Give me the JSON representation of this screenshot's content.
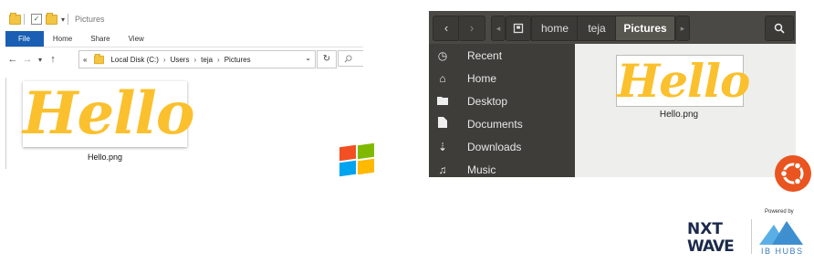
{
  "windows_explorer": {
    "title": "Pictures",
    "ribbon_tabs": [
      "File",
      "Home",
      "Share",
      "View"
    ],
    "breadcrumb": [
      "Local Disk (C:)",
      "Users",
      "teja",
      "Pictures"
    ],
    "breadcrumb_prefix": "«",
    "separator": "›",
    "file": {
      "image_text": "Hello",
      "name": "Hello.png"
    },
    "colors": {
      "file_tab": "#1a5fb4",
      "image_text": "#fbc02d"
    }
  },
  "ubuntu_files": {
    "path": [
      "home",
      "teja",
      "Pictures"
    ],
    "active_path": "Pictures",
    "sidebar": [
      {
        "label": "Recent",
        "icon": "clock-icon"
      },
      {
        "label": "Home",
        "icon": "home-icon"
      },
      {
        "label": "Desktop",
        "icon": "folder-icon"
      },
      {
        "label": "Documents",
        "icon": "document-icon"
      },
      {
        "label": "Downloads",
        "icon": "download-icon"
      },
      {
        "label": "Music",
        "icon": "music-icon"
      }
    ],
    "file": {
      "image_text": "Hello",
      "name": "Hello.png"
    },
    "colors": {
      "header": "#4a4945",
      "sidebar": "#3e3d39",
      "logo": "#e95420"
    }
  },
  "branding": {
    "line1": "NXT",
    "line2": "WAVE",
    "powered_by": "Powered by",
    "partner": "IB HUBS"
  }
}
